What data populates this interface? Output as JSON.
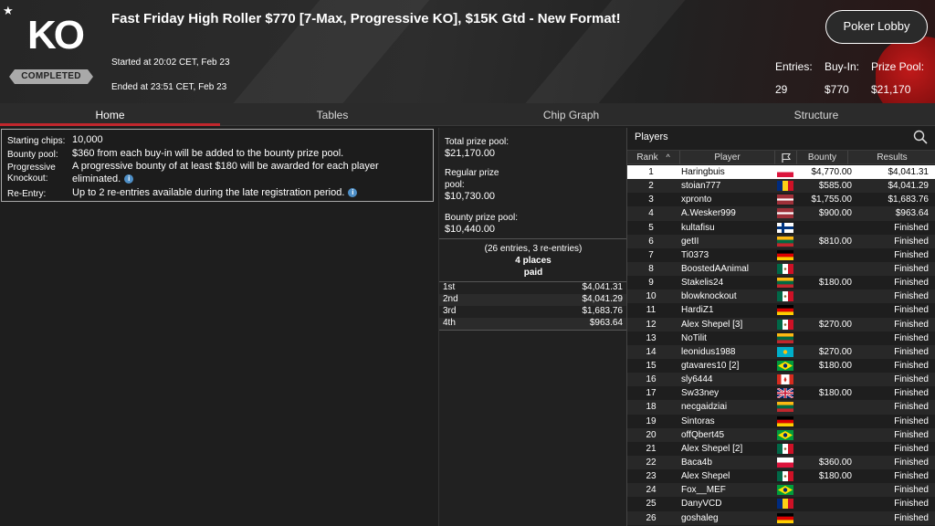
{
  "header": {
    "logo": "KO",
    "status": "COMPLETED",
    "title": "Fast Friday High Roller $770 [7-Max, Progressive KO], $15K Gtd - New Format!",
    "started": "Started at 20:02 CET, Feb 23",
    "ended": "Ended at 23:51 CET, Feb 23",
    "lobby_button": "Poker Lobby",
    "stats": {
      "entries_label": "Entries:",
      "entries_value": "29",
      "buyin_label": "Buy-In:",
      "buyin_value": "$770",
      "prizepool_label": "Prize Pool:",
      "prizepool_value": "$21,170"
    }
  },
  "tabs": [
    {
      "label": "Home",
      "active": true
    },
    {
      "label": "Tables",
      "active": false
    },
    {
      "label": "Chip Graph",
      "active": false
    },
    {
      "label": "Structure",
      "active": false
    }
  ],
  "info": {
    "starting_chips_label": "Starting chips:",
    "starting_chips_value": "10,000",
    "bounty_pool_label": "Bounty pool:",
    "bounty_pool_value": "$360 from each buy-in will be added to the bounty prize pool.",
    "progressive_label_1": "Progressive",
    "progressive_label_2": "Knockout:",
    "progressive_value_1": "A progressive bounty of at least $180 will be awarded for each player",
    "progressive_value_2": "eliminated.",
    "reentry_label": "Re-Entry:",
    "reentry_value": "Up to 2 re-entries available during the late registration period."
  },
  "prizes": {
    "total_label": "Total prize pool:",
    "total_value": "$21,170.00",
    "regular_label_1": "Regular prize",
    "regular_label_2": "pool:",
    "regular_value": "$10,730.00",
    "bounty_label": "Bounty prize pool:",
    "bounty_value": "$10,440.00",
    "entries_note": "(26 entries, 3 re-entries)",
    "places_1": "4 places",
    "places_2": "paid",
    "payouts": [
      {
        "place": "1st",
        "amount": "$4,041.31"
      },
      {
        "place": "2nd",
        "amount": "$4,041.29"
      },
      {
        "place": "3rd",
        "amount": "$1,683.76"
      },
      {
        "place": "4th",
        "amount": "$963.64"
      }
    ]
  },
  "players": {
    "title": "Players",
    "headers": {
      "rank": "Rank",
      "player": "Player",
      "bounty": "Bounty",
      "results": "Results"
    },
    "rows": [
      {
        "rank": "1",
        "name": "Haringbuis",
        "flag": "poland",
        "bounty": "$4,770.00",
        "result": "$4,041.31"
      },
      {
        "rank": "2",
        "name": "stoian777",
        "flag": "romania",
        "bounty": "$585.00",
        "result": "$4,041.29"
      },
      {
        "rank": "3",
        "name": "xpronto",
        "flag": "latvia",
        "bounty": "$1,755.00",
        "result": "$1,683.76"
      },
      {
        "rank": "4",
        "name": "A.Wesker999",
        "flag": "latvia",
        "bounty": "$900.00",
        "result": "$963.64"
      },
      {
        "rank": "5",
        "name": "kultafisu",
        "flag": "finland",
        "bounty": "",
        "result": "Finished"
      },
      {
        "rank": "6",
        "name": "getII",
        "flag": "lithuania",
        "bounty": "$810.00",
        "result": "Finished"
      },
      {
        "rank": "7",
        "name": "Ti0373",
        "flag": "germany",
        "bounty": "",
        "result": "Finished"
      },
      {
        "rank": "8",
        "name": "BoostedAAnimal",
        "flag": "mexico",
        "bounty": "",
        "result": "Finished"
      },
      {
        "rank": "9",
        "name": "Stakelis24",
        "flag": "lithuania",
        "bounty": "$180.00",
        "result": "Finished"
      },
      {
        "rank": "10",
        "name": "blowknockout",
        "flag": "mexico",
        "bounty": "",
        "result": "Finished"
      },
      {
        "rank": "11",
        "name": "HardiZ1",
        "flag": "germany",
        "bounty": "",
        "result": "Finished"
      },
      {
        "rank": "12",
        "name": "Alex Shepel [3]",
        "flag": "mexico",
        "bounty": "$270.00",
        "result": "Finished"
      },
      {
        "rank": "13",
        "name": "NoTilit",
        "flag": "lithuania",
        "bounty": "",
        "result": "Finished"
      },
      {
        "rank": "14",
        "name": "leonidus1988",
        "flag": "kazakhstan",
        "bounty": "$270.00",
        "result": "Finished"
      },
      {
        "rank": "15",
        "name": "gtavares10 [2]",
        "flag": "brazil",
        "bounty": "$180.00",
        "result": "Finished"
      },
      {
        "rank": "16",
        "name": "sly6444",
        "flag": "canada",
        "bounty": "",
        "result": "Finished"
      },
      {
        "rank": "17",
        "name": "Sw33ney",
        "flag": "uk",
        "bounty": "$180.00",
        "result": "Finished"
      },
      {
        "rank": "18",
        "name": "necgaidziai",
        "flag": "lithuania",
        "bounty": "",
        "result": "Finished"
      },
      {
        "rank": "19",
        "name": "Sintoras",
        "flag": "germany",
        "bounty": "",
        "result": "Finished"
      },
      {
        "rank": "20",
        "name": "offQbert45",
        "flag": "brazil",
        "bounty": "",
        "result": "Finished"
      },
      {
        "rank": "21",
        "name": "Alex Shepel [2]",
        "flag": "mexico",
        "bounty": "",
        "result": "Finished"
      },
      {
        "rank": "22",
        "name": "Baca4b",
        "flag": "poland",
        "bounty": "$360.00",
        "result": "Finished"
      },
      {
        "rank": "23",
        "name": "Alex Shepel",
        "flag": "mexico",
        "bounty": "$180.00",
        "result": "Finished"
      },
      {
        "rank": "24",
        "name": "Fox__MEF",
        "flag": "brazil",
        "bounty": "",
        "result": "Finished"
      },
      {
        "rank": "25",
        "name": "DanyVCD",
        "flag": "romania",
        "bounty": "",
        "result": "Finished"
      },
      {
        "rank": "26",
        "name": "goshaleg",
        "flag": "germany",
        "bounty": "",
        "result": "Finished"
      }
    ]
  },
  "colors": {
    "accent": "#c1272d",
    "info_icon": "#4e8fc7",
    "selected_row": "#ffffff"
  }
}
